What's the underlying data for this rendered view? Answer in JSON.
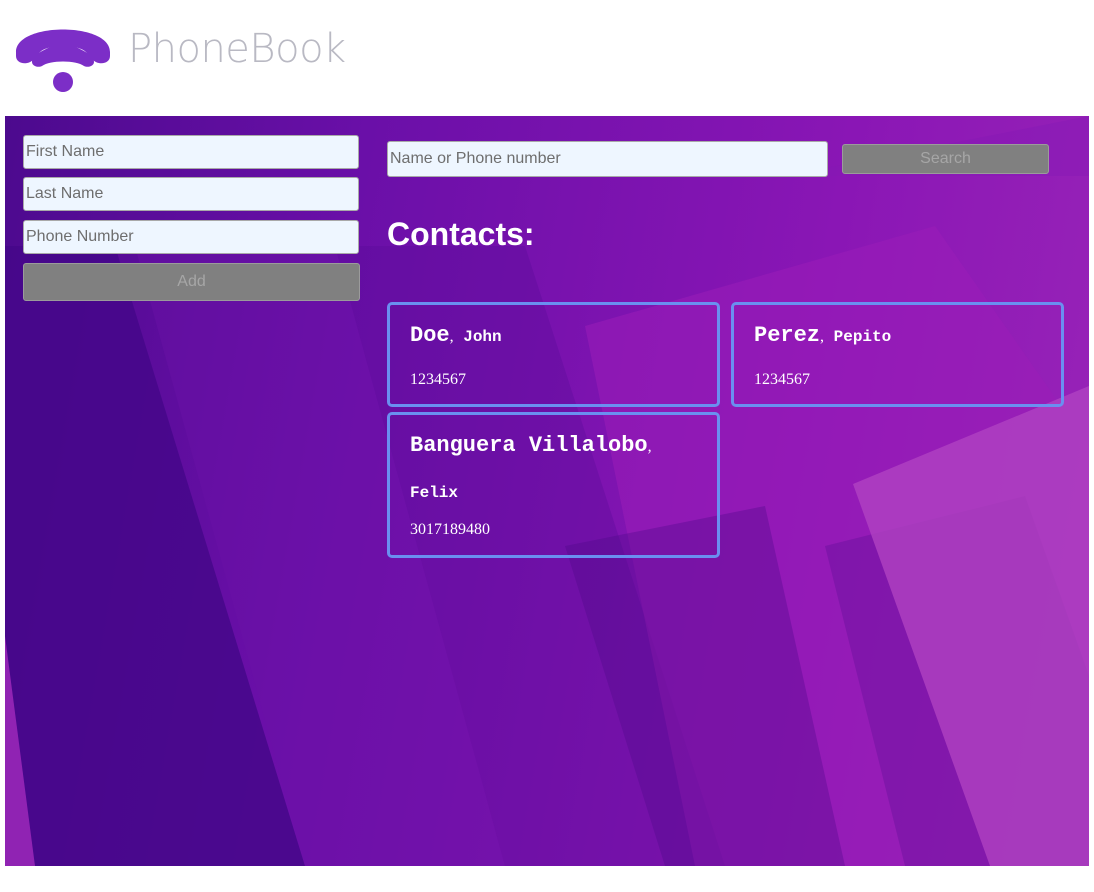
{
  "app": {
    "title": "PhoneBook",
    "logo_icon": "wifi-phone-icon",
    "brand_color": "#7c2ec7"
  },
  "add_form": {
    "first_name_placeholder": "First Name",
    "last_name_placeholder": "Last Name",
    "phone_placeholder": "Phone Number",
    "add_label": "Add"
  },
  "search": {
    "placeholder": "Name or Phone number",
    "button_label": "Search"
  },
  "contacts": {
    "heading": "Contacts:",
    "items": [
      {
        "last": "Doe",
        "first": "John",
        "phone": "1234567"
      },
      {
        "last": "Perez",
        "first": "Pepito",
        "phone": "1234567"
      },
      {
        "last": "Banguera Villalobo",
        "first": "Felix",
        "phone": "3017189480"
      }
    ]
  },
  "colors": {
    "card_border": "#6a8ff0",
    "button_bg": "#808080",
    "input_bg": "#eef6ff",
    "background": "#7a14ad"
  }
}
